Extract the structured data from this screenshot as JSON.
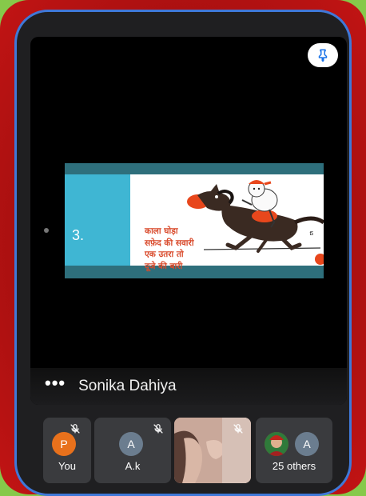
{
  "main_tile": {
    "speaker_name": "Sonika Dahiya",
    "more_dots": "•••",
    "slide": {
      "number": "3.",
      "rhyme_lines": [
        "काला घोड़ा",
        "सफ़ेद की सवारी",
        "एक उतरा तो",
        "दूजे की बारी"
      ]
    }
  },
  "participants": [
    {
      "label": "You",
      "initial": "P",
      "avatar_color": "#e8711c",
      "muted": true
    },
    {
      "label": "A.k",
      "initial": "A",
      "avatar_color": "#6b7d8f",
      "muted": true
    },
    {
      "label": "",
      "initial": "",
      "avatar_color": "",
      "muted": true
    },
    {
      "label": "25 others",
      "initial": "A",
      "avatar_color": "#6b7d8f",
      "muted": false
    }
  ],
  "colors": {
    "outer_background": "#86c94a",
    "frame_red": "#a30f0f",
    "frame_blue": "#3f78d8",
    "app_background": "#1f1f21",
    "tile_background": "#3a3b3e",
    "slide_teal": "#2e6f7c",
    "slide_cyan": "#3fb6d3",
    "rhyme_text": "#d94a2b"
  },
  "icons": [
    "pin-icon",
    "more-options-icon",
    "mic-off-icon"
  ]
}
